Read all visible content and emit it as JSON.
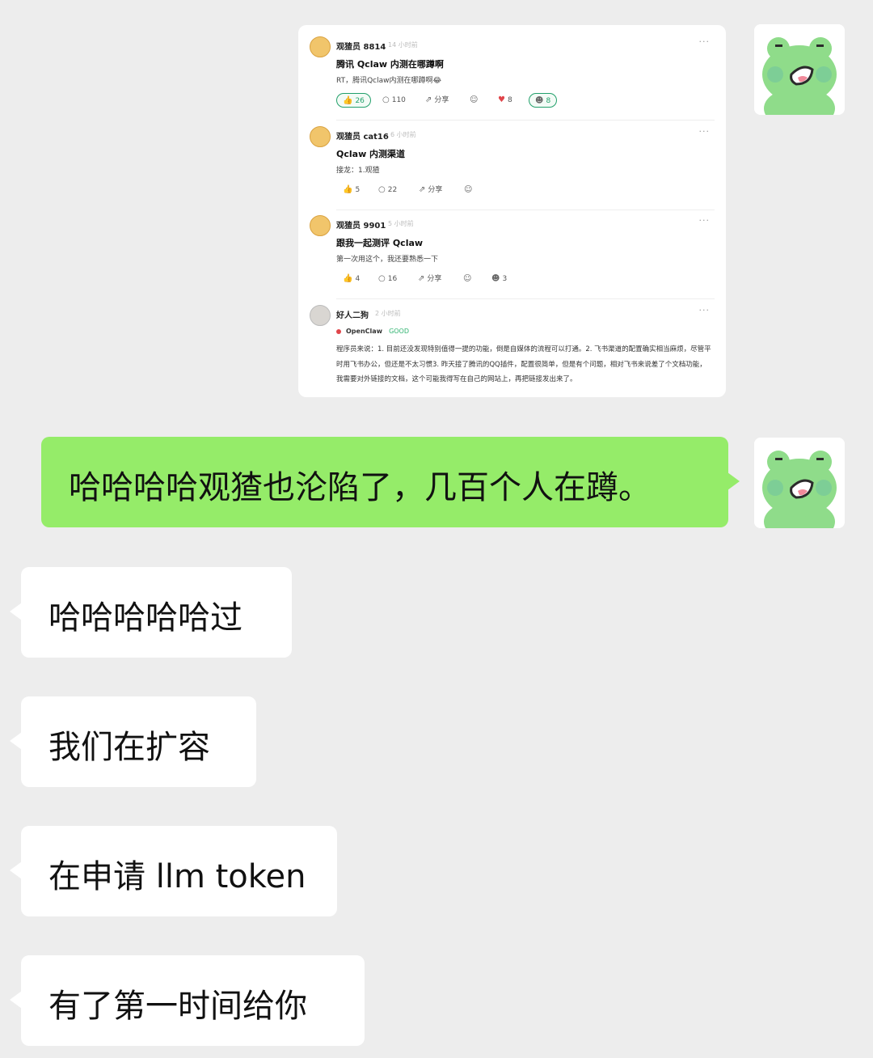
{
  "shared_screenshot": {
    "posts": [
      {
        "user": "观猹员 8814",
        "time": "14 小时前",
        "more": "···",
        "title": "腾讯 Qclaw 内测在哪蹲啊",
        "body": "RT，腾讯Qclaw内测在哪蹲啊😂",
        "likes": "26",
        "comments": "110",
        "share": "分享",
        "hearts": "8",
        "reaction": "8"
      },
      {
        "user": "观猹员 cat16",
        "time": "6 小时前",
        "more": "···",
        "title": "Qclaw 内测渠道",
        "body": "接龙：1.观猹",
        "likes": "5",
        "comments": "22",
        "share": "分享"
      },
      {
        "user": "观猹员 9901",
        "time": "5 小时前",
        "more": "···",
        "title": "跟我一起测评 Qclaw",
        "body": "第一次用这个，我还要熟悉一下",
        "likes": "4",
        "comments": "16",
        "share": "分享",
        "reaction": "3"
      },
      {
        "user": "好人二狗",
        "time": "2 小时前",
        "more": "···",
        "product": "OpenClaw",
        "rating": "GOOD",
        "text": "程序员来说：1. 目前还没发现特别值得一提的功能，倒是自媒体的流程可以打通。2. 飞书渠道的配置确实相当麻烦，尽管平时用飞书办公，但还是不太习惯3. 昨天接了腾讯的QQ插件，配置很简单，但是有个问题，相对飞书来说差了个文档功能，我需要对外链接的文档，这个可能我得写在自己的网站上，再把链接发出来了。"
      }
    ]
  },
  "messages": [
    {
      "side": "right",
      "text": "哈哈哈哈观猹也沦陷了，几百个人在蹲。"
    },
    {
      "side": "left",
      "text": "哈哈哈哈哈过"
    },
    {
      "side": "left",
      "text": "我们在扩容"
    },
    {
      "side": "left",
      "text": "在申请 llm token"
    },
    {
      "side": "left",
      "text": "有了第一时间给你"
    }
  ],
  "colors": {
    "background": "#ededed",
    "sent_bubble": "#95ec69",
    "received_bubble": "#ffffff",
    "avatar_frog": "#8fdc8a",
    "accent_green": "#22a06b"
  },
  "icons": {
    "avatar": "frog-avatar-icon",
    "like": "thumbs-up-icon",
    "comment": "comment-icon",
    "share": "share-icon",
    "emoji": "emoji-icon",
    "heart": "heart-icon",
    "reaction": "reaction-emoji-icon"
  }
}
